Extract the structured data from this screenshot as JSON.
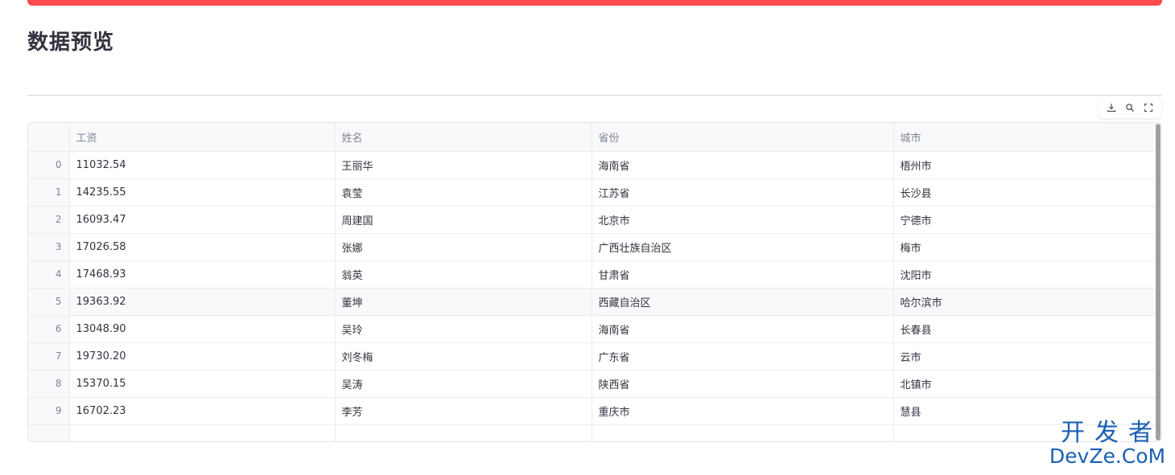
{
  "header": {
    "title": "数据预览"
  },
  "toolbar": {
    "download_icon": "download-icon",
    "search_icon": "search-icon",
    "fullscreen_icon": "fullscreen-icon"
  },
  "table": {
    "columns": [
      "",
      "工资",
      "姓名",
      "省份",
      "城市"
    ],
    "rows": [
      {
        "index": "0",
        "salary": "11032.54",
        "name": "王丽华",
        "province": "海南省",
        "city": "梧州市"
      },
      {
        "index": "1",
        "salary": "14235.55",
        "name": "袁莹",
        "province": "江苏省",
        "city": "长沙县"
      },
      {
        "index": "2",
        "salary": "16093.47",
        "name": "周建国",
        "province": "北京市",
        "city": "宁德市"
      },
      {
        "index": "3",
        "salary": "17026.58",
        "name": "张娜",
        "province": "广西壮族自治区",
        "city": "梅市"
      },
      {
        "index": "4",
        "salary": "17468.93",
        "name": "翁英",
        "province": "甘肃省",
        "city": "沈阳市"
      },
      {
        "index": "5",
        "salary": "19363.92",
        "name": "董坤",
        "province": "西藏自治区",
        "city": "哈尔滨市"
      },
      {
        "index": "6",
        "salary": "13048.90",
        "name": "吴玲",
        "province": "海南省",
        "city": "长春县"
      },
      {
        "index": "7",
        "salary": "19730.20",
        "name": "刘冬梅",
        "province": "广东省",
        "city": "云市"
      },
      {
        "index": "8",
        "salary": "15370.15",
        "name": "吴涛",
        "province": "陕西省",
        "city": "北镇市"
      },
      {
        "index": "9",
        "salary": "16702.23",
        "name": "李芳",
        "province": "重庆市",
        "city": "慧县"
      }
    ]
  },
  "watermark": {
    "cn": "开发者",
    "en": "DevZe.CoM"
  },
  "colors": {
    "accent": "#ff4b4b",
    "watermark": "#1a5fb4"
  }
}
